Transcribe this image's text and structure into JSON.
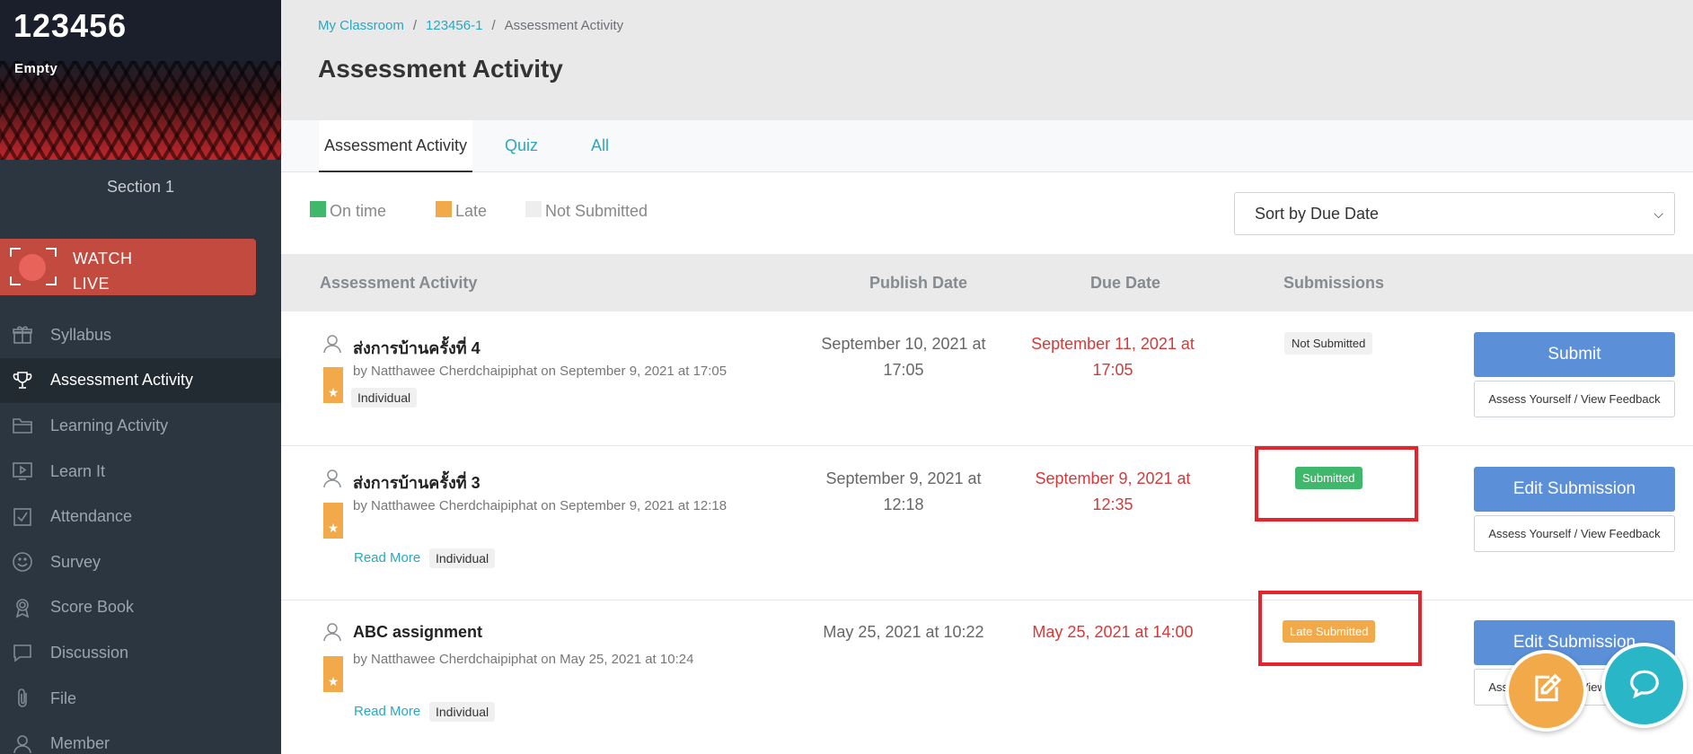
{
  "sidebar": {
    "course_code": "123456",
    "course_status": "Empty",
    "section": "Section 1",
    "watch_live": {
      "line1": "WATCH",
      "line2": "LIVE"
    },
    "items": [
      {
        "label": "Syllabus",
        "icon": "gift-icon"
      },
      {
        "label": "Assessment Activity",
        "icon": "trophy-icon",
        "active": true
      },
      {
        "label": "Learning Activity",
        "icon": "folder-icon"
      },
      {
        "label": "Learn It",
        "icon": "play-icon"
      },
      {
        "label": "Attendance",
        "icon": "checkbox-icon"
      },
      {
        "label": "Survey",
        "icon": "smile-icon"
      },
      {
        "label": "Score Book",
        "icon": "award-icon"
      },
      {
        "label": "Discussion",
        "icon": "chat-icon"
      },
      {
        "label": "File",
        "icon": "paperclip-icon"
      },
      {
        "label": "Member",
        "icon": "user-icon"
      }
    ]
  },
  "breadcrumb": {
    "item1": "My Classroom",
    "item2": "123456-1",
    "current": "Assessment Activity"
  },
  "page_title": "Assessment Activity",
  "tabs": {
    "assessment": "Assessment Activity",
    "quiz": "Quiz",
    "all": "All"
  },
  "legend": {
    "on_time": "On time",
    "late": "Late",
    "not_submitted": "Not Submitted",
    "colors": {
      "on_time": "#3fb86b",
      "late": "#f2a94a",
      "not_submitted": "#eeeeee"
    }
  },
  "sort": {
    "selected": "Sort by Due Date"
  },
  "table": {
    "headers": {
      "activity": "Assessment Activity",
      "publish": "Publish Date",
      "due": "Due Date",
      "submissions": "Submissions"
    },
    "rows": [
      {
        "title": "ส่งการบ้านครั้งที่ 4",
        "by": "by Natthawee Cherdchaipiphat on September 9, 2021 at 17:05",
        "tag": "Individual",
        "publish": "September 10, 2021 at 17:05",
        "due": "September 11, 2021 at 17:05",
        "status": "Not Submitted",
        "primary_btn": "Submit",
        "secondary_btn": "Assess Yourself / View Feedback"
      },
      {
        "title": "ส่งการบ้านครั้งที่ 3",
        "by": "by Natthawee Cherdchaipiphat on September 9, 2021 at 12:18",
        "read_more": "Read More",
        "tag": "Individual",
        "publish": "September 9, 2021 at 12:18",
        "due": "September 9, 2021 at 12:35",
        "status": "Submitted",
        "primary_btn": "Edit Submission",
        "secondary_btn": "Assess Yourself / View Feedback"
      },
      {
        "title": "ABC assignment",
        "by": "by Natthawee Cherdchaipiphat on May 25, 2021 at 10:24",
        "read_more": "Read More",
        "tag": "Individual",
        "publish": "May 25, 2021 at 10:22",
        "due": "May 25, 2021 at 14:00",
        "status": "Late Submitted",
        "primary_btn": "Edit Submission",
        "secondary_btn": "Assess Yourself / View Feedback"
      }
    ]
  },
  "fabs": {
    "compose": "edit-icon",
    "chat": "chat-bubble-icon"
  },
  "colors": {
    "accent": "#2aa8bf",
    "primary_button": "#5b8fd8",
    "due_date": "#d33a3a",
    "highlight": "#e6242b"
  }
}
